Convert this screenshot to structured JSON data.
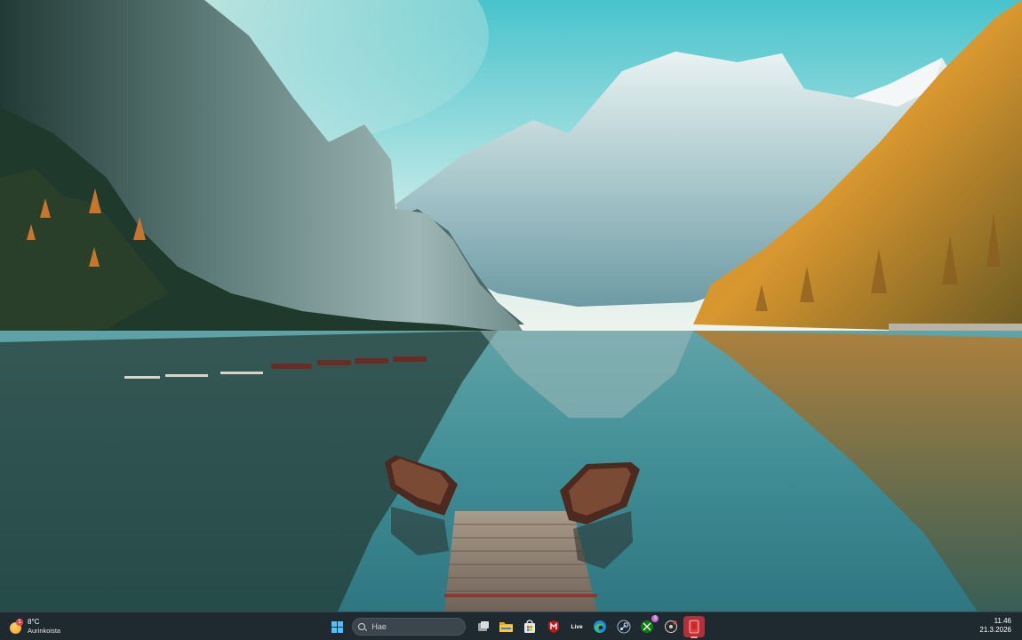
{
  "weather": {
    "temperature": "8°C",
    "condition": "Aurinkoista",
    "alert_count": "1"
  },
  "search": {
    "placeholder": "Hae"
  },
  "taskbar": {
    "apps": [
      {
        "name": "start",
        "icon": "windows-logo-icon"
      },
      {
        "name": "task-view",
        "icon": "task-view-icon"
      },
      {
        "name": "file-explorer",
        "icon": "folder-icon"
      },
      {
        "name": "microsoft-store",
        "icon": "store-icon"
      },
      {
        "name": "mcafee",
        "icon": "shield-m-icon"
      },
      {
        "name": "live-app",
        "icon": "live-text-icon",
        "label": "Live"
      },
      {
        "name": "edge",
        "icon": "edge-icon"
      },
      {
        "name": "steam",
        "icon": "steam-icon"
      },
      {
        "name": "xbox",
        "icon": "xbox-icon",
        "badge": "3"
      },
      {
        "name": "music-app",
        "icon": "record-icon"
      },
      {
        "name": "active-app",
        "icon": "red-app-icon",
        "active": true
      }
    ]
  },
  "clock": {
    "time": "11.46",
    "date": "21.3.2026"
  },
  "colors": {
    "taskbar_bg": "#1f2a30",
    "accent_blue": "#4cc2ff",
    "active_red": "#b0313a",
    "sky_top": "#47c3cc",
    "lake": "#3f8f95"
  }
}
